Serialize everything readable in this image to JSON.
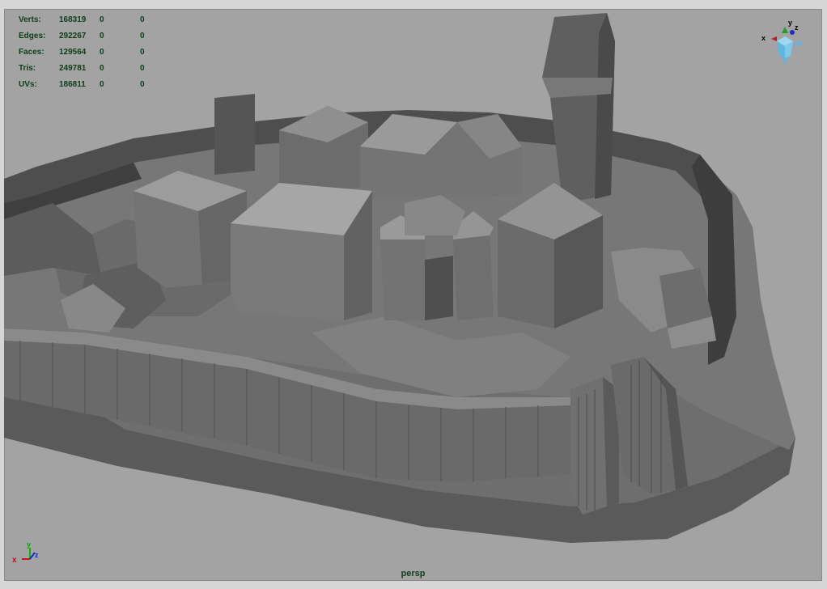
{
  "hud": {
    "rows": [
      {
        "label": "Verts:",
        "total": "168319",
        "sel": "0",
        "comp": "0"
      },
      {
        "label": "Edges:",
        "total": "292267",
        "sel": "0",
        "comp": "0"
      },
      {
        "label": "Faces:",
        "total": "129564",
        "sel": "0",
        "comp": "0"
      },
      {
        "label": "Tris:",
        "total": "249781",
        "sel": "0",
        "comp": "0"
      },
      {
        "label": "UVs:",
        "total": "186811",
        "sel": "0",
        "comp": "0"
      }
    ]
  },
  "view_cube": {
    "x": "x",
    "y": "y",
    "z": "z",
    "icon": "view-cube-icon"
  },
  "axis_indicator": {
    "x": "x",
    "y": "y",
    "z": "z",
    "icon": "axis-triad-icon"
  },
  "camera": {
    "label": "persp"
  },
  "colors": {
    "viewport_bg": "#a3a3a3",
    "hud_text": "#0f3d1a",
    "x_axis": "#d01010",
    "y_axis": "#10b010",
    "z_axis": "#1030d0"
  }
}
